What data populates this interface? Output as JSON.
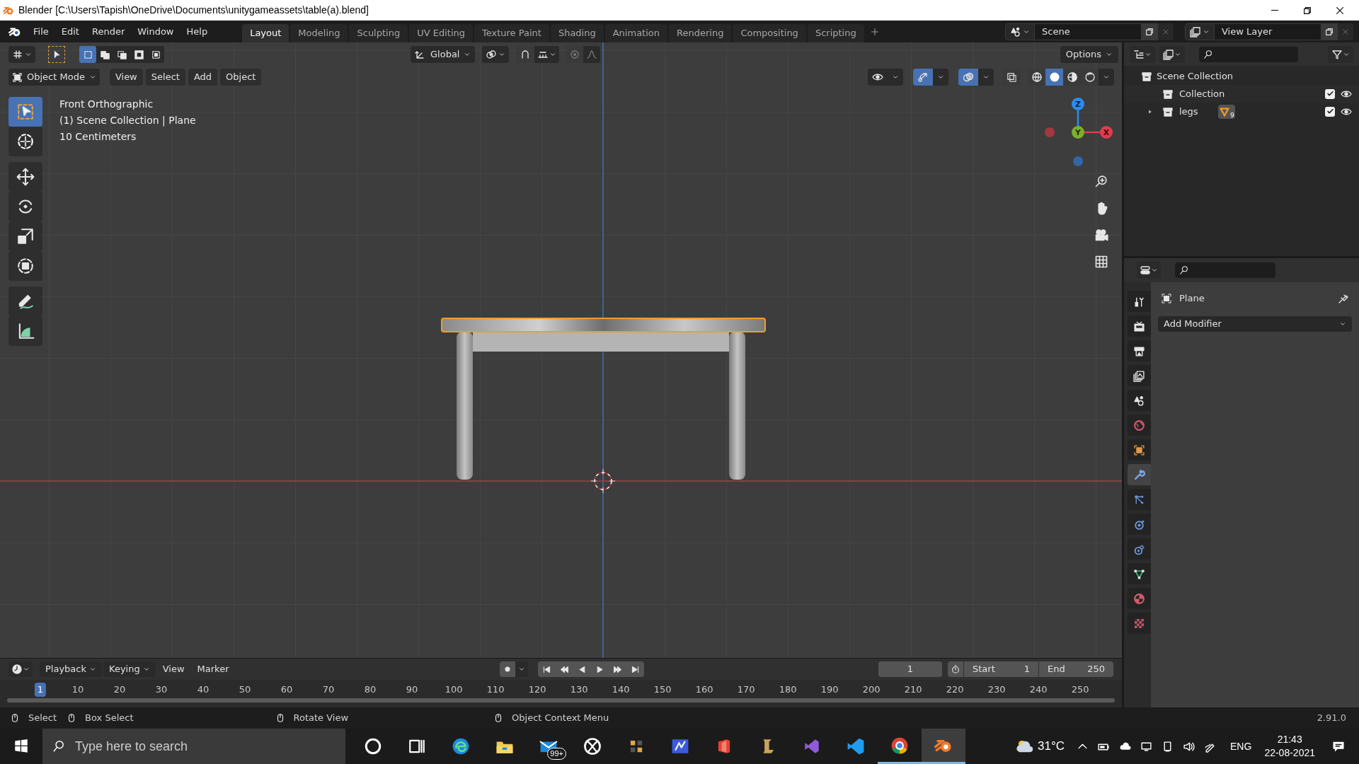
{
  "window": {
    "title": "Blender [C:\\Users\\Tapish\\OneDrive\\Documents\\unitygameassets\\table(a).blend]"
  },
  "menu": [
    "File",
    "Edit",
    "Render",
    "Window",
    "Help"
  ],
  "workspaces": [
    {
      "label": "Layout",
      "selected": true
    },
    {
      "label": "Modeling",
      "selected": false
    },
    {
      "label": "Sculpting",
      "selected": false
    },
    {
      "label": "UV Editing",
      "selected": false
    },
    {
      "label": "Texture Paint",
      "selected": false
    },
    {
      "label": "Shading",
      "selected": false
    },
    {
      "label": "Animation",
      "selected": false
    },
    {
      "label": "Rendering",
      "selected": false
    },
    {
      "label": "Compositing",
      "selected": false
    },
    {
      "label": "Scripting",
      "selected": false
    }
  ],
  "scene": "Scene",
  "view_layer": "View Layer",
  "viewport": {
    "mode": "Object Mode",
    "menus": [
      "View",
      "Select",
      "Add",
      "Object"
    ],
    "orientation": "Global",
    "options": "Options",
    "info": [
      "Front Orthographic",
      "(1) Scene Collection | Plane",
      "10 Centimeters"
    ],
    "select_modes": [
      {
        "selected": true
      },
      {
        "selected": false
      },
      {
        "selected": false
      },
      {
        "selected": false
      },
      {
        "selected": false
      }
    ],
    "tools": [
      {
        "kind": "select",
        "selected": true
      },
      {
        "kind": "cursor",
        "selected": false
      },
      {
        "kind": "move",
        "selected": false
      },
      {
        "kind": "rotate",
        "selected": false
      },
      {
        "kind": "scale",
        "selected": false
      },
      {
        "kind": "transform",
        "selected": false
      },
      {
        "kind": "annotate",
        "selected": false
      },
      {
        "kind": "measure",
        "selected": false
      }
    ],
    "shading": [
      {
        "selected": false
      },
      {
        "selected": true
      },
      {
        "selected": false
      },
      {
        "selected": false
      }
    ],
    "gizmo": {
      "x": "X",
      "y": "Y",
      "z": "Z"
    }
  },
  "outliner": {
    "root": "Scene Collection",
    "items": [
      {
        "name": "Collection",
        "checked": true,
        "expandable": false
      },
      {
        "name": "legs",
        "checked": true,
        "expandable": true,
        "badge": "9"
      }
    ]
  },
  "properties": {
    "object": "Plane",
    "add_modifier": "Add Modifier",
    "tabs": [
      {
        "kind": "tool",
        "selected": false
      },
      {
        "kind": "render",
        "selected": false
      },
      {
        "kind": "output",
        "selected": false
      },
      {
        "kind": "view_layer",
        "selected": false
      },
      {
        "kind": "scene",
        "selected": false
      },
      {
        "kind": "world",
        "selected": false
      },
      {
        "kind": "object",
        "selected": false
      },
      {
        "kind": "modifier",
        "selected": true
      },
      {
        "kind": "particles",
        "selected": false
      },
      {
        "kind": "physics",
        "selected": false
      },
      {
        "kind": "constraints",
        "selected": false
      },
      {
        "kind": "data",
        "selected": false
      },
      {
        "kind": "material",
        "selected": false
      },
      {
        "kind": "texture",
        "selected": false
      }
    ]
  },
  "timeline": {
    "menus": [
      "Playback",
      "Keying",
      "View",
      "Marker"
    ],
    "current_frame": "1",
    "start_label": "Start",
    "start": "1",
    "end_label": "End",
    "end": "250",
    "ruler": [
      {
        "label": "1",
        "selected": true
      },
      {
        "label": "10",
        "selected": false
      },
      {
        "label": "20",
        "selected": false
      },
      {
        "label": "30",
        "selected": false
      },
      {
        "label": "40",
        "selected": false
      },
      {
        "label": "50",
        "selected": false
      },
      {
        "label": "60",
        "selected": false
      },
      {
        "label": "70",
        "selected": false
      },
      {
        "label": "80",
        "selected": false
      },
      {
        "label": "90",
        "selected": false
      },
      {
        "label": "100",
        "selected": false
      },
      {
        "label": "110",
        "selected": false
      },
      {
        "label": "120",
        "selected": false
      },
      {
        "label": "130",
        "selected": false
      },
      {
        "label": "140",
        "selected": false
      },
      {
        "label": "150",
        "selected": false
      },
      {
        "label": "160",
        "selected": false
      },
      {
        "label": "170",
        "selected": false
      },
      {
        "label": "180",
        "selected": false
      },
      {
        "label": "190",
        "selected": false
      },
      {
        "label": "200",
        "selected": false
      },
      {
        "label": "210",
        "selected": false
      },
      {
        "label": "220",
        "selected": false
      },
      {
        "label": "230",
        "selected": false
      },
      {
        "label": "240",
        "selected": false
      },
      {
        "label": "250",
        "selected": false
      }
    ]
  },
  "status_bar": {
    "hints": [
      "Select",
      "Box Select",
      "Rotate View",
      "Object Context Menu"
    ],
    "version": "2.91.0"
  },
  "taskbar": {
    "search": {
      "placeholder": "Type here to search"
    },
    "apps": [
      {
        "kind": "cortana",
        "open": false,
        "selected": false
      },
      {
        "kind": "task_view",
        "open": false,
        "selected": false
      },
      {
        "kind": "edge",
        "open": false,
        "selected": false
      },
      {
        "kind": "explorer",
        "open": false,
        "selected": false
      },
      {
        "kind": "mail",
        "open": false,
        "selected": false,
        "badge": "99+"
      },
      {
        "kind": "xbox",
        "open": false,
        "selected": false
      },
      {
        "kind": "puzzle",
        "open": false,
        "selected": false
      },
      {
        "kind": "editor",
        "open": false,
        "selected": false
      },
      {
        "kind": "office",
        "open": false,
        "selected": false
      },
      {
        "kind": "game",
        "open": false,
        "selected": false
      },
      {
        "kind": "studio",
        "open": false,
        "selected": false
      },
      {
        "kind": "code",
        "open": false,
        "selected": false
      },
      {
        "kind": "chrome",
        "open": true,
        "selected": false
      },
      {
        "kind": "blender",
        "open": true,
        "selected": true
      }
    ],
    "temperature": "31°C",
    "language": "ENG",
    "time": "21:43",
    "date": "22-08-2021"
  }
}
